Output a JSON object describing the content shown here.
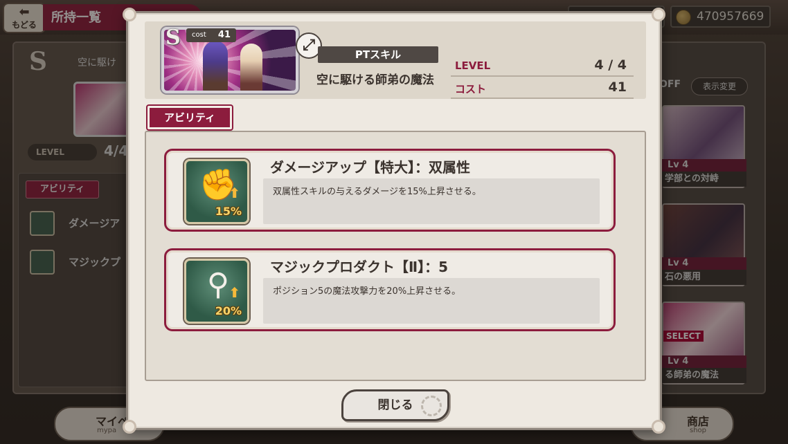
{
  "background": {
    "back_label": "もどる",
    "title": "所持一覧",
    "money": "470957669",
    "left_panel": {
      "rank": "S",
      "skill_title": "空に駆け",
      "level_label": "LEVEL",
      "level_value": "4/4",
      "ability_tab": "アビリティ",
      "abilities": [
        "ダメージア",
        "マジックプ"
      ]
    },
    "right_panel": {
      "toggle": "OFF",
      "display_change": "表示変更",
      "cards": [
        {
          "lv": "Lv 4",
          "name": "学部との対峙"
        },
        {
          "lv": "Lv 4",
          "name": "石の悪用"
        },
        {
          "lv": "Lv 4",
          "name": "る師弟の魔法",
          "select": "SELECT"
        }
      ]
    },
    "bottom_left": {
      "label": "マイペ",
      "sub": "mypa"
    },
    "bottom_right": {
      "label": "商店",
      "sub": "shop"
    }
  },
  "modal": {
    "card": {
      "rank": "S",
      "cost_label": "cost",
      "cost_value": "41"
    },
    "pt_skill_label": "PTスキル",
    "skill_name": "空に駆ける師弟の魔法",
    "stats": {
      "level_label": "LEVEL",
      "level_value": "4 / 4",
      "cost_label": "コスト",
      "cost_value": "41"
    },
    "ability_tab": "アビリティ",
    "abilities": [
      {
        "title": "ダメージアップ【特大】：双属性",
        "description": "双属性スキルの与えるダメージを15%上昇させる。",
        "icon": "fist-up-icon",
        "badge": "15%"
      },
      {
        "title": "マジックプロダクト【Ⅱ】：5",
        "description": "ポジション5の魔法攻撃力を20%上昇させる。",
        "icon": "magic-wand-icon",
        "badge": "20%"
      }
    ],
    "close_label": "閉じる"
  },
  "colors": {
    "accent": "#8c1c3d",
    "panel": "#eee9e1",
    "icon_bg": "#2f5a47"
  }
}
